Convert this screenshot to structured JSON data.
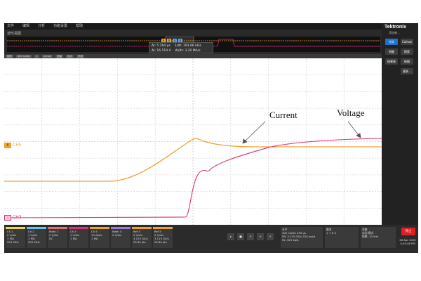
{
  "menu": [
    "文件",
    "编辑",
    "分析",
    "功能设置",
    "帮助"
  ],
  "brand": {
    "name": "Tektronix",
    "sub": "添加新..."
  },
  "zoom": {
    "label": "波形视图",
    "readout_lines": [
      "ΔI: 5.164 µs",
      "ΔI: 16.519 A",
      "1/Δt: 193.66 kHz",
      "ΔI/Δt: 3.20 MA/s"
    ],
    "marks": [
      "a",
      "b",
      "a",
      "b"
    ]
  },
  "toolbar": {
    "buttons": [
      "缩放",
      "400 ns/div",
      "1",
      "Cursor",
      "测量",
      "加大",
      "关闭"
    ]
  },
  "side": {
    "buttons": [
      "光标",
      "Callout",
      "测量",
      "搜索",
      "结果表",
      "绘图",
      "更多..."
    ]
  },
  "channels": [
    {
      "name": "CH5",
      "color": "#f0a030"
    },
    {
      "name": "CH3",
      "color": "#e0307a"
    }
  ],
  "annotations": {
    "current": "Current",
    "voltage": "Voltage"
  },
  "badges": [
    {
      "title": "Ch 1",
      "line1": "2 V/div",
      "line2": "1 MΩ",
      "line3": "500 MHz",
      "color": "#e8d84a"
    },
    {
      "title": "Ch 2",
      "line1": "1 V/div",
      "line2": "1 MΩ",
      "line3": "500 MHz",
      "color": "#60c8f0"
    },
    {
      "title": "Math 2",
      "line1": "2 V/div",
      "line2": "DC",
      "line3": "",
      "color": "#e07070"
    },
    {
      "title": "Ch 3",
      "line1": "1 V/div",
      "line2": "1 MΩ",
      "line3": "",
      "color": "#e0307a"
    },
    {
      "title": "Ch 5",
      "line1": "10 A/div",
      "line2": "1 MΩ",
      "line3": "",
      "color": "#f0a030"
    },
    {
      "title": "Math 4",
      "line1": "2 V/div",
      "line2": "",
      "line3": "",
      "color": "#9b7ad8"
    },
    {
      "title": "Ref 3",
      "line1": "2 V/div",
      "line2": "3.125 GS/s",
      "line3": "25.6k pts",
      "color": "#f0a030"
    },
    {
      "title": "Ref 5",
      "line1": "2 V/div",
      "line2": "3.125 GS/s",
      "line3": "25.6k pts",
      "color": "#f0a030"
    }
  ],
  "acquisition": {
    "title": "水平",
    "line1": "400 ns/div  200 µs",
    "line2": "SR: 3.125 GS/s  320 ps/pt",
    "line3": "RL: 625 kpts"
  },
  "trigger": {
    "title": "触发",
    "line1": "1 ∿  8 V"
  },
  "acq": {
    "title": "采集",
    "line1": "自动  模式",
    "line2": "帧数: 10 kHz"
  },
  "run_label": "停止",
  "datetime": [
    "26 Apr 2020",
    "4:45:46 PM"
  ]
}
